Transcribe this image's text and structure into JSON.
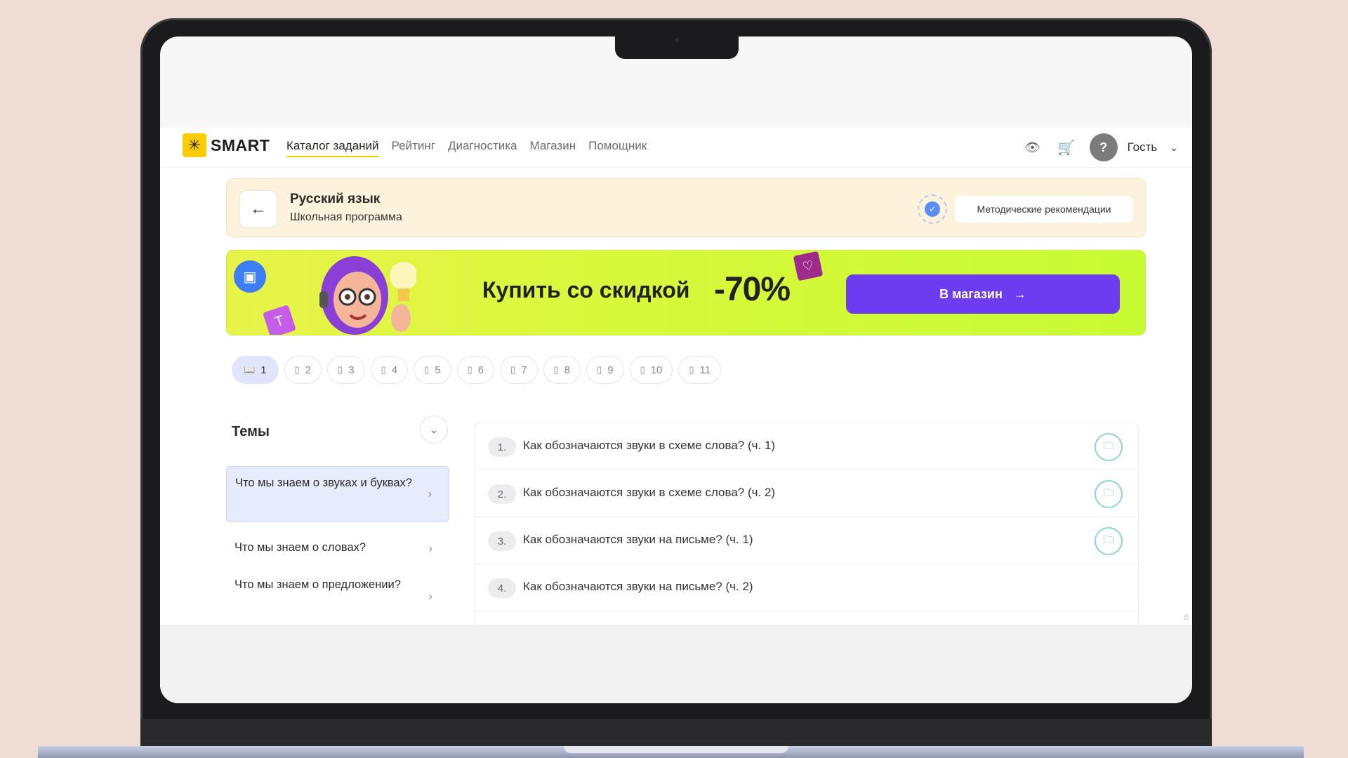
{
  "navbar": {
    "logo_text": "SMART",
    "links": [
      "Каталог заданий",
      "Рейтинг",
      "Диагностика",
      "Магазин",
      "Помощник"
    ],
    "active_link": "Каталог заданий",
    "avatar_symbol": "?",
    "user_name": "Гость"
  },
  "subject": {
    "title": "Русский язык",
    "subtitle": "Школьная программа",
    "method_button": "Методические рекомендации"
  },
  "promo": {
    "text": "Купить со скидкой",
    "discount": "-70%",
    "button_label": "В магазин",
    "tile_letter": "Т"
  },
  "grades": {
    "items": [
      "1",
      "2",
      "3",
      "4",
      "5",
      "6",
      "7",
      "8",
      "9",
      "10",
      "11"
    ],
    "active": "1"
  },
  "topics": {
    "title": "Темы",
    "items": [
      "Что мы знаем о звуках и буквах?",
      "Что мы знаем о словах?",
      "Что мы знаем о предложении?"
    ]
  },
  "lessons": [
    {
      "num": "1.",
      "title": "Как обозначаются звуки в схеме слова? (ч. 1)"
    },
    {
      "num": "2.",
      "title": "Как обозначаются звуки в схеме слова? (ч. 2)"
    },
    {
      "num": "3.",
      "title": "Как обозначаются звуки на письме? (ч. 1)"
    },
    {
      "num": "4.",
      "title": "Как обозначаются звуки на письме? (ч. 2)"
    }
  ],
  "scroll_label": "В",
  "colors": {
    "accent_purple": "#6d3cf0",
    "logo_yellow": "#ffcc00",
    "promo_green": "#d9f83c",
    "folder_teal": "#8fd3cc"
  }
}
